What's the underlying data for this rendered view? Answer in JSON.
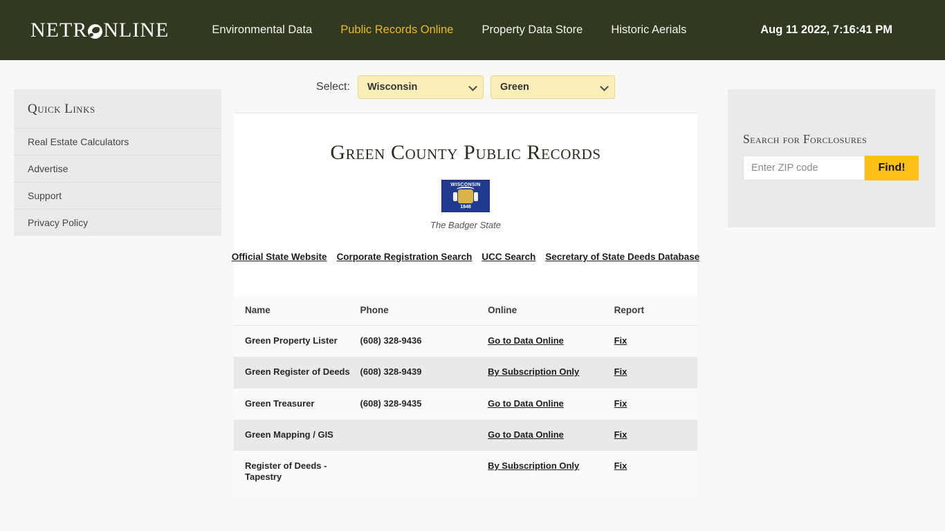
{
  "header": {
    "logo_text_pre": "NETR",
    "logo_icon": "globe-icon",
    "logo_text_post": "NLINE",
    "nav": [
      {
        "label": "Environmental Data",
        "active": false
      },
      {
        "label": "Public Records Online",
        "active": true
      },
      {
        "label": "Property Data Store",
        "active": false
      },
      {
        "label": "Historic Aerials",
        "active": false
      }
    ],
    "timestamp": "Aug 11 2022, 7:16:41 PM"
  },
  "sidebar_left": {
    "title": "Quick Links",
    "items": [
      {
        "label": "Real Estate Calculators"
      },
      {
        "label": "Advertise"
      },
      {
        "label": "Support"
      },
      {
        "label": "Privacy Policy"
      }
    ]
  },
  "selectors": {
    "label": "Select:",
    "state": {
      "value": "Wisconsin"
    },
    "county": {
      "value": "Green"
    }
  },
  "main": {
    "title": "Green County Public Records",
    "flag": {
      "state_name": "WISCONSIN",
      "year": "1848",
      "caption": "The Badger State"
    },
    "state_links": [
      {
        "label": "Official State Website"
      },
      {
        "label": "Corporate Registration Search"
      },
      {
        "label": "UCC Search"
      },
      {
        "label": "Secretary of State Deeds Database"
      }
    ],
    "table": {
      "columns": [
        "Name",
        "Phone",
        "Online",
        "Report"
      ],
      "rows": [
        {
          "name": "Green Property Lister",
          "phone": "(608) 328-9436",
          "online": "Go to Data Online",
          "report": "Fix"
        },
        {
          "name": "Green Register of Deeds",
          "phone": "(608) 328-9439",
          "online": "By Subscription Only",
          "report": "Fix"
        },
        {
          "name": "Green Treasurer",
          "phone": "(608) 328-9435",
          "online": "Go to Data Online",
          "report": "Fix"
        },
        {
          "name": "Green Mapping / GIS",
          "phone": "",
          "online": "Go to Data Online",
          "report": "Fix"
        },
        {
          "name": "Register of Deeds - Tapestry",
          "phone": "",
          "online": "By Subscription Only",
          "report": "Fix"
        }
      ]
    }
  },
  "sidebar_right": {
    "title": "Search for Forclosures",
    "zip_placeholder": "Enter ZIP code",
    "zip_value": "",
    "find_label": "Find!"
  },
  "colors": {
    "header_bg": "#313a20",
    "accent_gold": "#e8b830",
    "button_yellow": "#fcc017",
    "select_yellow": "#fbeeb8",
    "panel_gray": "#eaeaea",
    "flag_blue": "#1f3a8f"
  }
}
